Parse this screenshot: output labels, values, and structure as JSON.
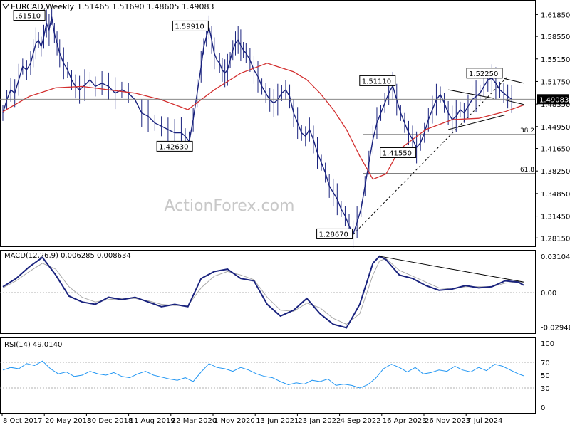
{
  "chart_data": {
    "type": "line",
    "symbol": "EURCAD,Weekly",
    "ohlc_header": "1.51465 1.51690 1.48605 1.49083",
    "watermark": "ActionForex.com",
    "current_price_label": "1.49083",
    "x_axis_labels": [
      "8 Oct 2017",
      "20 May 2018",
      "30 Dec 2018",
      "11 Aug 2019",
      "22 Mar 2020",
      "1 Nov 2020",
      "13 Jun 2021",
      "23 Jan 2022",
      "4 Sep 2022",
      "16 Apr 2023",
      "26 Nov 2023",
      "7 Jul 2024"
    ],
    "price_axis": {
      "ylim": [
        1.27,
        1.635
      ],
      "ticks": [
        "1.61850",
        "1.58550",
        "1.55150",
        "1.51750",
        "1.48350",
        "1.44950",
        "1.41650",
        "1.38250",
        "1.34850",
        "1.31450",
        "1.28150"
      ]
    },
    "price_series": {
      "name": "",
      "x": [
        0,
        3,
        6,
        9,
        12,
        15,
        18,
        21,
        23,
        25,
        27,
        29,
        31,
        33,
        35,
        37,
        39,
        41,
        43,
        46,
        49,
        52,
        55,
        58,
        62,
        66,
        70,
        75,
        80,
        85,
        90,
        95,
        100,
        105,
        110,
        115,
        120,
        125,
        130,
        135,
        138,
        141,
        144,
        147,
        150,
        152,
        154,
        156,
        158,
        160,
        162,
        164,
        166,
        168,
        170,
        172,
        174,
        176,
        178,
        180,
        182,
        184,
        187,
        190,
        193,
        196,
        199,
        202,
        205,
        208,
        211,
        214,
        217,
        220,
        223,
        226,
        229,
        232,
        235,
        238,
        241,
        244,
        247,
        250,
        253,
        256,
        259,
        262,
        265,
        268,
        271,
        274,
        277,
        280,
        283,
        286,
        289,
        292,
        295,
        298,
        301,
        304,
        307,
        310,
        313,
        316,
        319,
        322,
        325,
        328,
        331,
        334,
        337,
        340,
        343,
        346,
        349,
        352,
        355,
        358,
        361,
        364,
        367,
        370,
        373,
        376,
        379,
        382,
        385,
        388,
        391,
        394
      ],
      "values": [
        1.47,
        1.49,
        1.505,
        1.5,
        1.52,
        1.54,
        1.535,
        1.545,
        1.56,
        1.575,
        1.58,
        1.57,
        1.585,
        1.605,
        1.595,
        1.615,
        1.59,
        1.575,
        1.56,
        1.545,
        1.535,
        1.52,
        1.51,
        1.505,
        1.512,
        1.52,
        1.51,
        1.515,
        1.51,
        1.5,
        1.505,
        1.5,
        1.49,
        1.47,
        1.465,
        1.455,
        1.45,
        1.445,
        1.44,
        1.44,
        1.435,
        1.427,
        1.46,
        1.5,
        1.54,
        1.57,
        1.585,
        1.599,
        1.58,
        1.56,
        1.55,
        1.545,
        1.535,
        1.53,
        1.535,
        1.55,
        1.565,
        1.575,
        1.58,
        1.572,
        1.565,
        1.56,
        1.55,
        1.535,
        1.525,
        1.51,
        1.5,
        1.49,
        1.485,
        1.49,
        1.5,
        1.505,
        1.495,
        1.47,
        1.455,
        1.44,
        1.435,
        1.445,
        1.43,
        1.41,
        1.395,
        1.38,
        1.36,
        1.35,
        1.34,
        1.325,
        1.315,
        1.3,
        1.287,
        1.305,
        1.325,
        1.36,
        1.395,
        1.43,
        1.455,
        1.47,
        1.485,
        1.5,
        1.511,
        1.49,
        1.47,
        1.455,
        1.44,
        1.43,
        1.418,
        1.425,
        1.44,
        1.46,
        1.475,
        1.49,
        1.498,
        1.485,
        1.47,
        1.46,
        1.465,
        1.475,
        1.47,
        1.48,
        1.49,
        1.495,
        1.5,
        1.51,
        1.52,
        1.5225,
        1.515,
        1.505,
        1.5,
        1.495,
        1.49083
      ]
    },
    "moving_average": {
      "name": "",
      "x": [
        0,
        20,
        40,
        60,
        80,
        100,
        120,
        140,
        160,
        180,
        200,
        220,
        230,
        240,
        250,
        260,
        270,
        280,
        290,
        300,
        320,
        340,
        360,
        380,
        394
      ],
      "values": [
        1.472,
        1.495,
        1.508,
        1.51,
        1.505,
        1.5,
        1.49,
        1.475,
        1.505,
        1.53,
        1.545,
        1.532,
        1.52,
        1.5,
        1.475,
        1.445,
        1.405,
        1.37,
        1.378,
        1.415,
        1.445,
        1.46,
        1.462,
        1.472,
        1.482
      ]
    },
    "annotations": [
      {
        "text": ".61510",
        "x": 20,
        "y": 1.6151
      },
      {
        "text": "1.42630",
        "x": 144,
        "y": 1.4263
      },
      {
        "text": "1.59910",
        "x": 156,
        "y": 1.5991
      },
      {
        "text": "1.28670",
        "x": 265,
        "y": 1.2867
      },
      {
        "text": "1.51110",
        "x": 298,
        "y": 1.5111
      },
      {
        "text": "1.41550",
        "x": 313,
        "y": 1.4155
      },
      {
        "text": "1.52250",
        "x": 379,
        "y": 1.5225
      }
    ],
    "fib_levels": [
      {
        "label": "38.2",
        "value": 1.4375
      },
      {
        "label": "61.8",
        "value": 1.3785
      }
    ],
    "macd": {
      "label": "MACD(12,26,9) 0.006285 0.008634",
      "ylim": [
        -0.034,
        0.034
      ],
      "ticks": [
        "0.031048",
        "0.00",
        "-0.029469"
      ],
      "x": [
        0,
        10,
        20,
        30,
        40,
        50,
        60,
        70,
        80,
        90,
        100,
        110,
        120,
        130,
        140,
        150,
        160,
        170,
        180,
        190,
        200,
        210,
        220,
        230,
        240,
        250,
        260,
        270,
        280,
        285,
        290,
        300,
        310,
        320,
        330,
        340,
        350,
        360,
        370,
        380,
        390,
        394
      ],
      "values": [
        0.005,
        0.012,
        0.022,
        0.03,
        0.015,
        -0.003,
        -0.008,
        -0.01,
        -0.004,
        -0.006,
        -0.004,
        -0.008,
        -0.012,
        -0.01,
        -0.012,
        0.012,
        0.018,
        0.02,
        0.012,
        0.01,
        -0.01,
        -0.02,
        -0.015,
        -0.005,
        -0.018,
        -0.027,
        -0.03,
        -0.01,
        0.025,
        0.031,
        0.028,
        0.015,
        0.012,
        0.006,
        0.002,
        0.003,
        0.006,
        0.004,
        0.005,
        0.01,
        0.009,
        0.0063
      ],
      "signal_values": [
        0.004,
        0.01,
        0.018,
        0.025,
        0.02,
        0.005,
        -0.004,
        -0.008,
        -0.006,
        -0.005,
        -0.005,
        -0.007,
        -0.01,
        -0.011,
        -0.011,
        0.004,
        0.014,
        0.018,
        0.015,
        0.011,
        -0.004,
        -0.015,
        -0.016,
        -0.009,
        -0.013,
        -0.022,
        -0.027,
        -0.018,
        0.015,
        0.027,
        0.029,
        0.019,
        0.014,
        0.009,
        0.004,
        0.003,
        0.005,
        0.005,
        0.005,
        0.008,
        0.009,
        0.0086
      ]
    },
    "rsi": {
      "label": "RSI(14) 49.0140",
      "ylim": [
        0,
        100
      ],
      "ticks": [
        "100",
        "70",
        "50",
        "30",
        "0"
      ],
      "levels": [
        70,
        30
      ],
      "x": [
        0,
        6,
        12,
        18,
        24,
        30,
        36,
        42,
        48,
        54,
        60,
        66,
        72,
        78,
        84,
        90,
        96,
        102,
        108,
        114,
        120,
        126,
        132,
        138,
        144,
        150,
        156,
        162,
        168,
        174,
        180,
        186,
        192,
        198,
        204,
        210,
        216,
        222,
        228,
        234,
        240,
        246,
        252,
        258,
        264,
        270,
        276,
        282,
        288,
        294,
        300,
        306,
        312,
        318,
        324,
        330,
        336,
        342,
        348,
        354,
        360,
        366,
        372,
        378,
        384,
        390,
        394
      ],
      "values": [
        58,
        62,
        60,
        68,
        65,
        72,
        60,
        52,
        55,
        48,
        50,
        56,
        52,
        50,
        54,
        48,
        46,
        52,
        56,
        50,
        47,
        44,
        42,
        46,
        40,
        55,
        68,
        62,
        60,
        56,
        62,
        58,
        52,
        48,
        46,
        40,
        35,
        38,
        36,
        42,
        40,
        44,
        34,
        36,
        34,
        30,
        35,
        45,
        60,
        67,
        62,
        55,
        62,
        52,
        54,
        58,
        56,
        64,
        58,
        55,
        62,
        57,
        67,
        64,
        58,
        52,
        49
      ]
    }
  }
}
